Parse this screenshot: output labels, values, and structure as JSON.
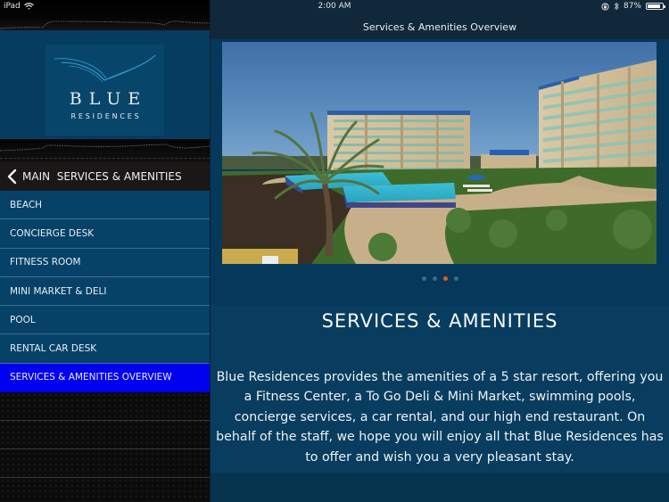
{
  "status_bar": {
    "device": "iPad",
    "wifi_icon": "wifi-icon",
    "time": "2:00 AM",
    "orientation_lock_icon": "orientation-lock-icon",
    "bluetooth_icon": "bluetooth-icon",
    "battery_percent": "87%",
    "battery_level": 0.87
  },
  "sidebar": {
    "logo": {
      "line1": "BLUE",
      "line2": "RESIDENCES"
    },
    "back_button": {
      "icon": "chevron-left-icon",
      "label": "MAIN  SERVICES & AMENITIES"
    },
    "items": [
      {
        "label": "BEACH",
        "active": false
      },
      {
        "label": "CONCIERGE DESK",
        "active": false
      },
      {
        "label": "FITNESS ROOM",
        "active": false
      },
      {
        "label": "MINI MARKET & DELI",
        "active": false
      },
      {
        "label": "POOL",
        "active": false
      },
      {
        "label": "RENTAL CAR DESK",
        "active": false
      },
      {
        "label": "SERVICES & AMENITIES OVERVIEW",
        "active": true
      }
    ],
    "active_color": "#0000ee"
  },
  "main": {
    "nav_title": "Services & Amenities Overview",
    "carousel": {
      "image_alt": "Resort buildings with palm tree and swimming pools",
      "page_count": 4,
      "current_page": 3,
      "active_dot_color": "#e55a1a"
    },
    "heading": "SERVICES & AMENITIES",
    "body": "Blue Residences provides the amenities of a 5 star resort, offering you a Fitness Center, a To Go Deli & Mini Market, swimming pools, concierge services, a car rental, and our high end restaurant. On behalf of the staff, we hope you will enjoy all that Blue Residences has to offer and wish you a very pleasant stay."
  }
}
